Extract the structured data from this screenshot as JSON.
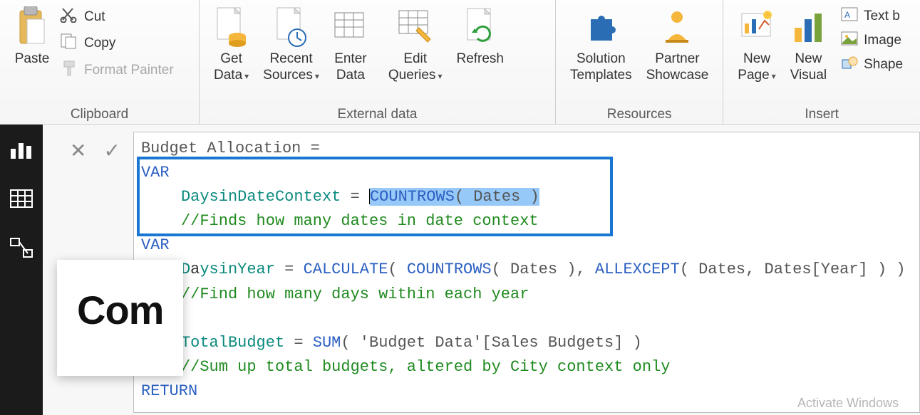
{
  "ribbon": {
    "clipboard": {
      "paste": "Paste",
      "cut": "Cut",
      "copy": "Copy",
      "formatPainter": "Format Painter",
      "group": "Clipboard"
    },
    "external": {
      "getData": "Get\nData",
      "recentSources": "Recent\nSources",
      "enterData": "Enter\nData",
      "editQueries": "Edit\nQueries",
      "refresh": "Refresh",
      "group": "External data"
    },
    "resources": {
      "solutionTemplates": "Solution\nTemplates",
      "partnerShowcase": "Partner\nShowcase",
      "group": "Resources"
    },
    "insert": {
      "newPage": "New\nPage",
      "newVisual": "New\nVisual",
      "textBox": "Text b",
      "image": "Image",
      "shapes": "Shape",
      "group": "Insert"
    }
  },
  "formula": {
    "line1": "Budget Allocation =",
    "var": "VAR",
    "daysContext_name": "DaysinDateContext",
    "eq": " = ",
    "countrows": "COUNTROWS",
    "dates": " Dates ",
    "daysContext_comment": "//Finds how many dates in date context",
    "daysYear_namePre": "D",
    "daysYear_nameRest": "ysinYear",
    "calculate": "CALCULATE",
    "allexcept": "ALLEXCEPT",
    "datesYear": "Dates[Year]",
    "datesArg": " Dates",
    "daysYear_comment": "//Find how many days within each year",
    "totalBudget_name": "TotalBudget",
    "sum": "SUM",
    "budgetTable": "'Budget Data'[Sales Budgets]",
    "totalBudget_comment": "//Sum up total budgets, altered by City context only",
    "return": "RETURN"
  },
  "report": {
    "titleFragment": "Com"
  },
  "watermark": "Activate Windows"
}
